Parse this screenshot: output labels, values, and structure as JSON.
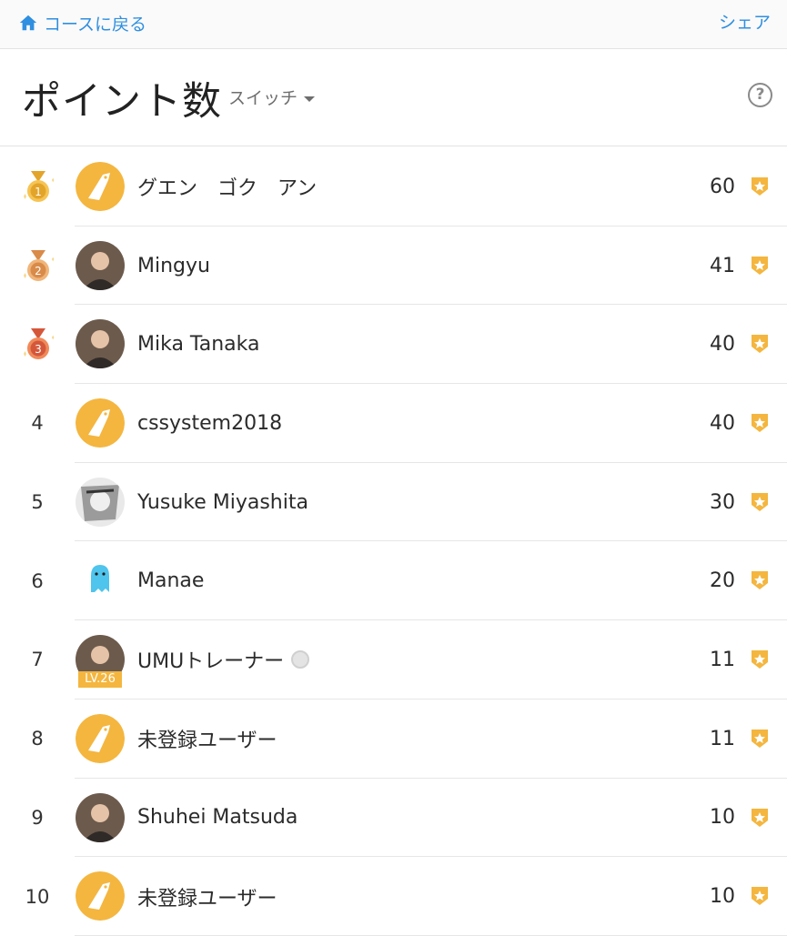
{
  "topbar": {
    "back_label": "コースに戻る",
    "share_label": "シェア"
  },
  "header": {
    "title": "ポイント数",
    "switch_label": "スイッチ",
    "help_symbol": "?"
  },
  "colors": {
    "link": "#2f8fe0",
    "accent": "#f4b63f"
  },
  "ranking": [
    {
      "rank": "1",
      "medal": "gold",
      "name": "グエン　ゴク　アン",
      "points": "60",
      "avatar": "giraffe-avatar"
    },
    {
      "rank": "2",
      "medal": "silver",
      "name": "Mingyu",
      "points": "41",
      "avatar": "photo-avatar"
    },
    {
      "rank": "3",
      "medal": "bronze",
      "name": "Mika Tanaka",
      "points": "40",
      "avatar": "photo-avatar"
    },
    {
      "rank": "4",
      "name": "cssystem2018",
      "points": "40",
      "avatar": "giraffe-avatar"
    },
    {
      "rank": "5",
      "name": "Yusuke Miyashita",
      "points": "30",
      "avatar": "manga-avatar"
    },
    {
      "rank": "6",
      "name": "Manae",
      "points": "20",
      "avatar": "ghost-avatar"
    },
    {
      "rank": "7",
      "name": "UMUトレーナー",
      "points": "11",
      "avatar": "photo-avatar",
      "level": "LV.26",
      "verified": true
    },
    {
      "rank": "8",
      "name": "未登録ユーザー",
      "points": "11",
      "avatar": "giraffe-avatar"
    },
    {
      "rank": "9",
      "name": "Shuhei Matsuda",
      "points": "10",
      "avatar": "photo-avatar"
    },
    {
      "rank": "10",
      "name": "未登録ユーザー",
      "points": "10",
      "avatar": "giraffe-avatar"
    }
  ]
}
